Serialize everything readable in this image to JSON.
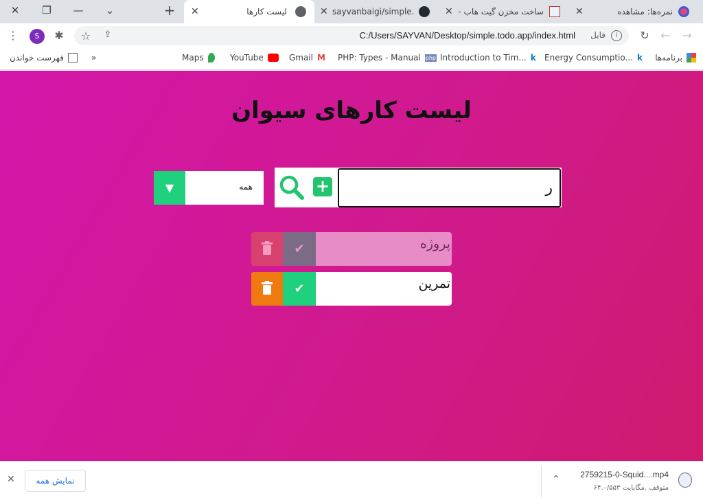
{
  "browser": {
    "tabs": [
      {
        "title": "نمره‌ها: مشاهده"
      },
      {
        "title": "ساخت مخزن گیت هاب -"
      },
      {
        "title": "sayvanbaigi/simple.tod"
      },
      {
        "title": "لیست کارها"
      }
    ],
    "url": "C:/Users/SAYVAN/Desktop/simple.todo.app/index.html",
    "site_label": "فایل",
    "profile_initial": "S",
    "bookmarks": {
      "apps": "برنامه‌ها",
      "items": [
        "Energy Consumptio...",
        "Introduction to Tim...",
        "PHP: Types - Manual",
        "Gmail",
        "YouTube",
        "Maps"
      ],
      "more": "»",
      "reading_list": "فهرست خواندن"
    }
  },
  "app": {
    "title": "لیست کارهای سیوان",
    "input_value": "ر",
    "filter_value": "همه",
    "todos": [
      {
        "text": "پروژه",
        "completed": true
      },
      {
        "text": "تمرین",
        "completed": false
      }
    ]
  },
  "downloads": {
    "file_name": "2759215-0-Squid....mp4",
    "status": "متوقف .مگابایت ۶۴.۰/۵۵۳",
    "show_all": "نمایش همه"
  }
}
